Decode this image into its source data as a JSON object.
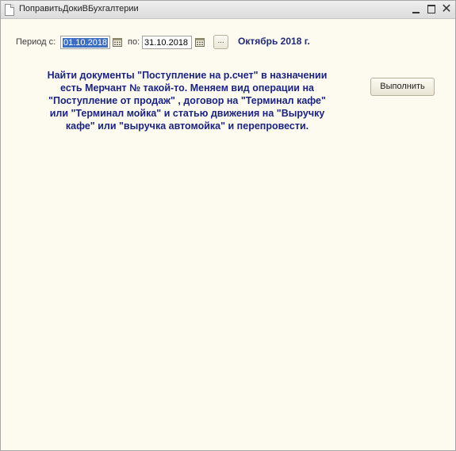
{
  "window": {
    "title": "ПоправитьДокиВБухгалтерии"
  },
  "form": {
    "period_label": "Период с:",
    "date_from": "01.10.2018",
    "to_label": "по:",
    "date_to": "31.10.2018",
    "select_period_label": "...",
    "period_text": "Октябрь 2018 г.",
    "description": "Найти документы  \"Поступление на р.счет\" в назначении\nесть Мерчант № такой-то. Меняем вид операции на\n\"Поступление от продаж\" , договор на \"Терминал кафе\"\nили \"Терминал мойка\" и статью движения на \"Выручку\nкафе\" или \"выручка автомойка\" и перепровести.",
    "run_label": "Выполнить"
  },
  "icons": {
    "document": "document-icon",
    "calendar": "calendar-icon",
    "minimize": "minimize-icon",
    "maximize": "maximize-icon",
    "close": "close-icon"
  }
}
